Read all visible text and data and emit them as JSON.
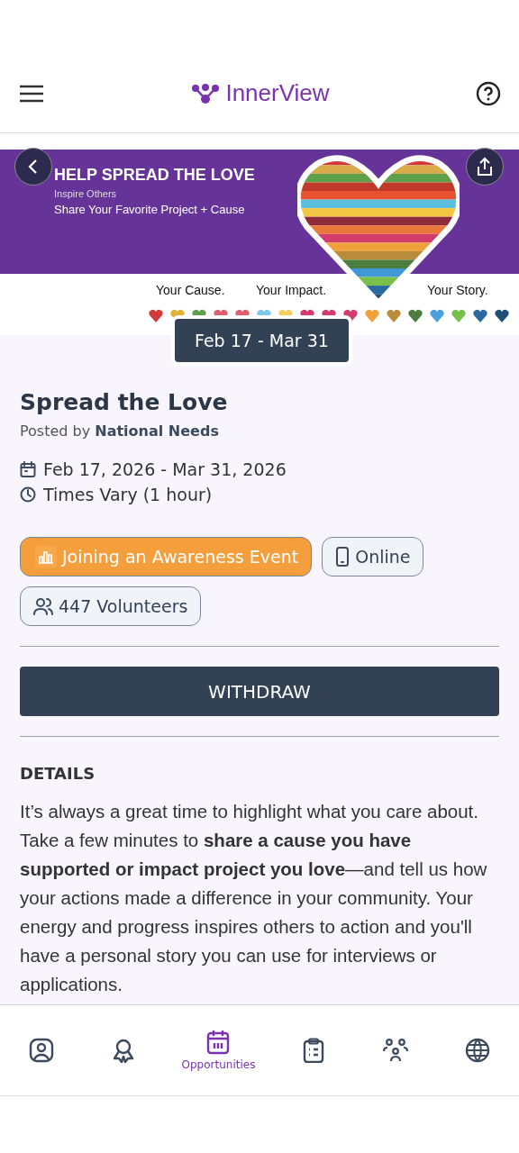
{
  "header": {
    "brand": "InnerView"
  },
  "banner": {
    "headline": "HELP SPREAD THE LOVE",
    "subtitle": "Inspire Others",
    "tagline": "Share Your Favorite Project + Cause",
    "captions": [
      "Your Cause.",
      "Your Impact.",
      "Your Story."
    ]
  },
  "date_badge": "Feb 17 - Mar 31",
  "event": {
    "title": "Spread the Love",
    "posted_prefix": "Posted by",
    "organizer": "National Needs",
    "dates": "Feb 17, 2026 - Mar 31, 2026",
    "time": "Times Vary (1 hour)"
  },
  "tags": [
    {
      "kind": "category",
      "label": "Joining an Awareness Event"
    },
    {
      "kind": "online",
      "label": "Online"
    },
    {
      "kind": "volunteers",
      "label": "447 Volunteers"
    }
  ],
  "action": "WITHDRAW",
  "details": {
    "heading": "DETAILS",
    "text": "It’s always a great time to highlight what you care about. Take a few minutes to **share a cause you have supported or impact project you love**—and tell us how your actions made a difference in your community. Your energy and progress inspires others to action and you'll have a personal story you can use for interviews or applications."
  },
  "nav": [
    {
      "selected": false
    },
    {
      "selected": false
    },
    {
      "selected": true,
      "label": "Opportunities"
    },
    {
      "selected": false
    },
    {
      "selected": false
    },
    {
      "selected": false
    }
  ]
}
